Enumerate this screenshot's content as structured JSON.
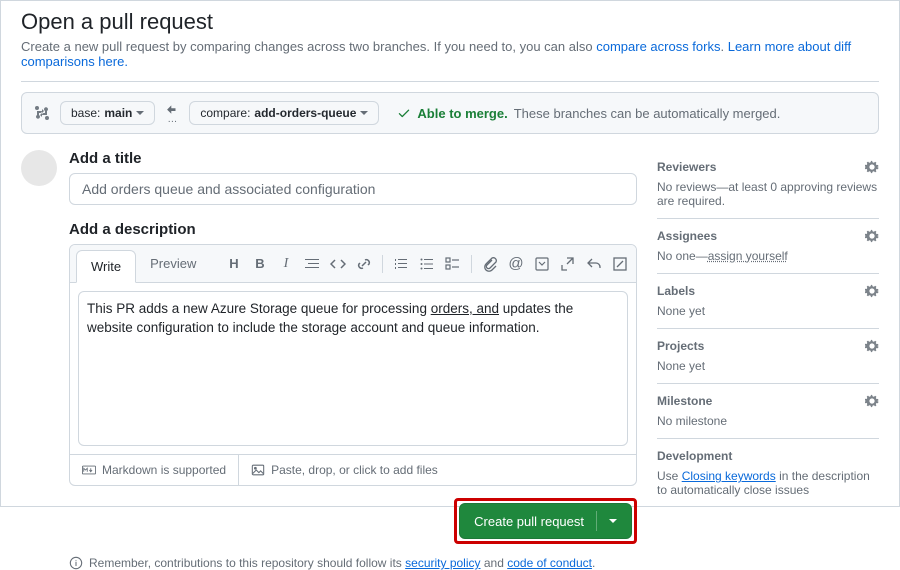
{
  "header": {
    "title": "Open a pull request",
    "subtitle_prefix": "Create a new pull request by comparing changes across two branches. If you need to, you can also ",
    "link_compare": "compare across forks",
    "subtitle_mid": ". ",
    "link_learn": "Learn more about diff comparisons here.",
    "subtitle_suffix": ""
  },
  "branches": {
    "base_label": "base: ",
    "base_value": "main",
    "compare_label": "compare: ",
    "compare_value": "add-orders-queue",
    "merge_status": "Able to merge.",
    "merge_note": "These branches can be automatically merged."
  },
  "form": {
    "title_label": "Add a title",
    "title_value": "Add orders queue and associated configuration",
    "desc_label": "Add a description",
    "tab_write": "Write",
    "tab_preview": "Preview",
    "desc_prefix": "This PR adds a new Azure Storage queue for processing ",
    "desc_underlined": "orders, and",
    "desc_suffix": " updates the website configuration to include the storage account and queue information.",
    "footer_md": "Markdown is supported",
    "footer_paste": "Paste, drop, or click to add files",
    "submit_label": "Create pull request"
  },
  "contrib": {
    "prefix": "Remember, contributions to this repository should follow its ",
    "link1": "security policy",
    "mid": " and ",
    "link2": "code of conduct",
    "suffix": "."
  },
  "sidebar": {
    "reviewers": {
      "title": "Reviewers",
      "body": "No reviews—at least 0 approving reviews are required."
    },
    "assignees": {
      "title": "Assignees",
      "body_prefix": "No one—",
      "body_link": "assign yourself"
    },
    "labels": {
      "title": "Labels",
      "body": "None yet"
    },
    "projects": {
      "title": "Projects",
      "body": "None yet"
    },
    "milestone": {
      "title": "Milestone",
      "body": "No milestone"
    },
    "development": {
      "title": "Development",
      "body_prefix": "Use ",
      "body_link": "Closing keywords",
      "body_suffix": " in the description to automatically close issues"
    }
  }
}
